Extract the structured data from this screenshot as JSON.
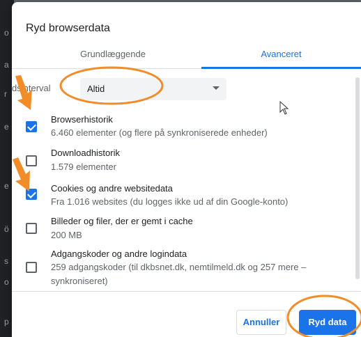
{
  "background": {
    "letters": [
      "o",
      "a",
      "r",
      "e",
      "e",
      "ö",
      "s",
      "o",
      "p"
    ]
  },
  "dialog": {
    "title": "Ryd browserdata"
  },
  "tabs": [
    {
      "label": "Grundlæggende",
      "selected": false
    },
    {
      "label": "Avanceret",
      "selected": true
    }
  ],
  "time_range": {
    "label": "Tidsinterval",
    "label_visible_fragment": "dsinterval",
    "value": "Altid"
  },
  "items": [
    {
      "label": "Browserhistorik",
      "description": "6.460 elementer (og flere på synkroniserede enheder)",
      "checked": true
    },
    {
      "label": "Downloadhistorik",
      "description": "1.579 elementer",
      "checked": false
    },
    {
      "label": "Cookies og andre websitedata",
      "description": "Fra 1.016 websites (du logges ikke ud af din Google-konto)",
      "checked": true
    },
    {
      "label": "Billeder og filer, der er gemt i cache",
      "description": "200 MB",
      "checked": false
    },
    {
      "label": "Adgangskoder og andre logindata",
      "description": "259 adgangskoder (til dkbsnet.dk, nemtilmeld.dk og 257 mere – synkroniseret)",
      "checked": false
    }
  ],
  "buttons": {
    "cancel": "Annuller",
    "clear": "Ryd data"
  },
  "colors": {
    "accent": "#1a73e8",
    "annotation": "#f28c28"
  }
}
